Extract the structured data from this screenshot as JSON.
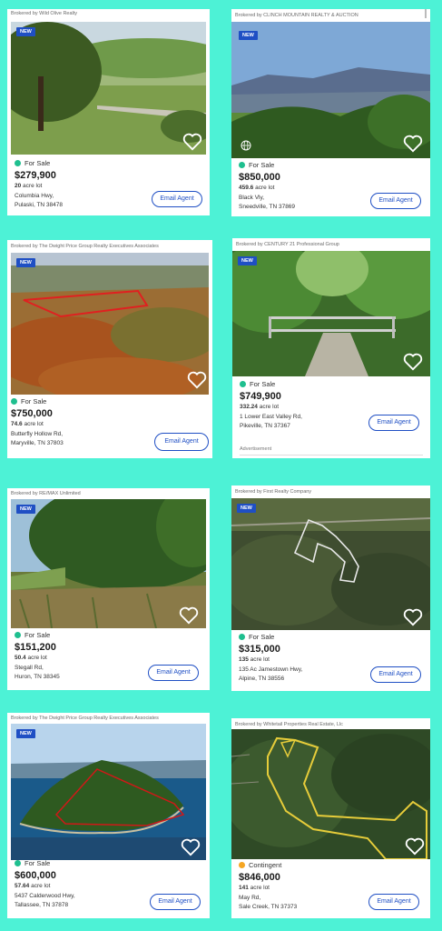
{
  "colors": {
    "background": "#4df2d6",
    "accent": "#1f4fc4",
    "for_sale": "#1fbf8f",
    "contingent": "#f5a623"
  },
  "listings": [
    {
      "broker": "Brokered by Wild Olive Realty",
      "badge": "NEW",
      "status": "For Sale",
      "status_color": "#1fbf8f",
      "price": "$279,900",
      "lot_size": "20",
      "lot_unit": "acre lot",
      "street": "Columbia Hwy,",
      "city": "Pulaski, TN 38478",
      "cta": "Email Agent",
      "image_icon": "forest-road-photo"
    },
    {
      "broker": "Brokered by CLINCH MOUNTAIN REALTY & AUCTION",
      "badge": "NEW",
      "status": "For Sale",
      "status_color": "#1fbf8f",
      "price": "$850,000",
      "lot_size": "459.6",
      "lot_unit": "acre lot",
      "street": "Black Vly,",
      "city": "Sneedville, TN 37869",
      "cta": "Email Agent",
      "image_icon": "mountain-view-photo"
    },
    {
      "broker": "Brokered by The Dwight Price Group Realty Executives Associates",
      "badge": "NEW",
      "status": "For Sale",
      "status_color": "#1fbf8f",
      "price": "$750,000",
      "lot_size": "74.6",
      "lot_unit": "acre lot",
      "street": "Butterfly Hollow Rd,",
      "city": "Maryville, TN 37803",
      "cta": "Email Agent",
      "image_icon": "aerial-autumn-photo"
    },
    {
      "broker": "Brokered by CENTURY 21 Professional Group",
      "badge": "NEW",
      "status": "For Sale",
      "status_color": "#1fbf8f",
      "price": "$749,900",
      "lot_size": "332.24",
      "lot_unit": "acre lot",
      "street": "1 Lower East Valley Rd,",
      "city": "Pikeville, TN 37367",
      "cta": "Email Agent",
      "advertisement": "Advertisement",
      "image_icon": "gate-photo"
    },
    {
      "broker": "Brokered by RE/MAX Unlimited",
      "badge": "NEW",
      "status": "For Sale",
      "status_color": "#1fbf8f",
      "price": "$151,200",
      "lot_size": "50.4",
      "lot_unit": "acre lot",
      "street": "Stegall Rd,",
      "city": "Huron, TN 38345",
      "cta": "Email Agent",
      "image_icon": "woods-edge-photo"
    },
    {
      "broker": "Brokered by First Realty Company",
      "badge": "NEW",
      "status": "For Sale",
      "status_color": "#1fbf8f",
      "price": "$315,000",
      "lot_size": "135",
      "lot_unit": "acre lot",
      "street": "135 Ac Jamestown Hwy,",
      "city": "Alpine, TN 38556",
      "cta": "Email Agent",
      "image_icon": "satellite-parcel-photo"
    },
    {
      "broker": "Brokered by The Dwight Price Group Realty Executives Associates",
      "badge": "NEW",
      "status": "For Sale",
      "status_color": "#1fbf8f",
      "price": "$600,000",
      "lot_size": "57.64",
      "lot_unit": "acre lot",
      "street": "5437 Calderwood Hwy,",
      "city": "Tallassee, TN 37878",
      "cta": "Email Agent",
      "image_icon": "lake-aerial-photo"
    },
    {
      "broker": "Brokered by Whitetail Properties Real Estate, Llc",
      "badge": "",
      "status": "Contingent",
      "status_color": "#f5a623",
      "price": "$846,000",
      "lot_size": "141",
      "lot_unit": "acre lot",
      "street": "May Rd,",
      "city": "Sale Creek, TN 37373",
      "cta": "Email Agent",
      "image_icon": "satellite-boundary-photo"
    }
  ]
}
